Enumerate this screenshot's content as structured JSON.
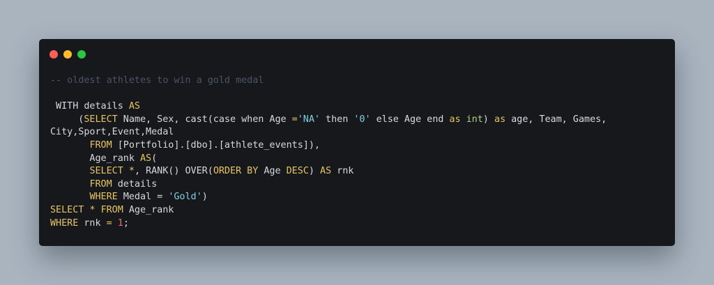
{
  "window": {
    "dots": [
      {
        "name": "close",
        "color": "#ff5f57"
      },
      {
        "name": "minimize",
        "color": "#febc2e"
      },
      {
        "name": "maximize",
        "color": "#28c840"
      }
    ]
  },
  "code_lines": [
    [
      {
        "t": "comment",
        "s": "-- oldest athletes to win a gold medal"
      }
    ],
    [],
    [
      {
        "t": "ident",
        "s": " WITH details "
      },
      {
        "t": "keyword",
        "s": "AS"
      }
    ],
    [
      {
        "t": "ident",
        "s": "     ("
      },
      {
        "t": "keyword",
        "s": "SELECT"
      },
      {
        "t": "ident",
        "s": " Name, Sex, cast(case when Age "
      },
      {
        "t": "keyword",
        "s": "="
      },
      {
        "t": "string",
        "s": "'NA'"
      },
      {
        "t": "ident",
        "s": " then "
      },
      {
        "t": "string",
        "s": "'0'"
      },
      {
        "t": "ident",
        "s": " else Age end "
      },
      {
        "t": "keyword",
        "s": "as"
      },
      {
        "t": "ident",
        "s": " "
      },
      {
        "t": "type",
        "s": "int"
      },
      {
        "t": "ident",
        "s": ") "
      },
      {
        "t": "keyword",
        "s": "as"
      },
      {
        "t": "ident",
        "s": " age, Team, Games,"
      }
    ],
    [
      {
        "t": "ident",
        "s": "City,Sport,Event,Medal"
      }
    ],
    [
      {
        "t": "ident",
        "s": "       "
      },
      {
        "t": "keyword",
        "s": "FROM"
      },
      {
        "t": "ident",
        "s": " [Portfolio].[dbo].[athlete_events]),"
      }
    ],
    [
      {
        "t": "ident",
        "s": "       Age_rank "
      },
      {
        "t": "keyword",
        "s": "AS"
      },
      {
        "t": "ident",
        "s": "("
      }
    ],
    [
      {
        "t": "ident",
        "s": "       "
      },
      {
        "t": "keyword",
        "s": "SELECT"
      },
      {
        "t": "ident",
        "s": " "
      },
      {
        "t": "keyword",
        "s": "*"
      },
      {
        "t": "ident",
        "s": ", RANK() OVER("
      },
      {
        "t": "keyword",
        "s": "ORDER BY"
      },
      {
        "t": "ident",
        "s": " Age "
      },
      {
        "t": "keyword",
        "s": "DESC"
      },
      {
        "t": "ident",
        "s": ") "
      },
      {
        "t": "keyword",
        "s": "AS"
      },
      {
        "t": "ident",
        "s": " rnk"
      }
    ],
    [
      {
        "t": "ident",
        "s": "       "
      },
      {
        "t": "keyword",
        "s": "FROM"
      },
      {
        "t": "ident",
        "s": " details"
      }
    ],
    [
      {
        "t": "ident",
        "s": "       "
      },
      {
        "t": "keyword",
        "s": "WHERE"
      },
      {
        "t": "ident",
        "s": " Medal = "
      },
      {
        "t": "string",
        "s": "'Gold'"
      },
      {
        "t": "ident",
        "s": ")"
      }
    ],
    [
      {
        "t": "keyword",
        "s": "SELECT"
      },
      {
        "t": "ident",
        "s": " "
      },
      {
        "t": "keyword",
        "s": "*"
      },
      {
        "t": "ident",
        "s": " "
      },
      {
        "t": "keyword",
        "s": "FROM"
      },
      {
        "t": "ident",
        "s": " Age_rank"
      }
    ],
    [
      {
        "t": "keyword",
        "s": "WHERE"
      },
      {
        "t": "ident",
        "s": " rnk "
      },
      {
        "t": "keyword",
        "s": "="
      },
      {
        "t": "ident",
        "s": " "
      },
      {
        "t": "number",
        "s": "1"
      },
      {
        "t": "ident",
        "s": ";"
      }
    ]
  ]
}
